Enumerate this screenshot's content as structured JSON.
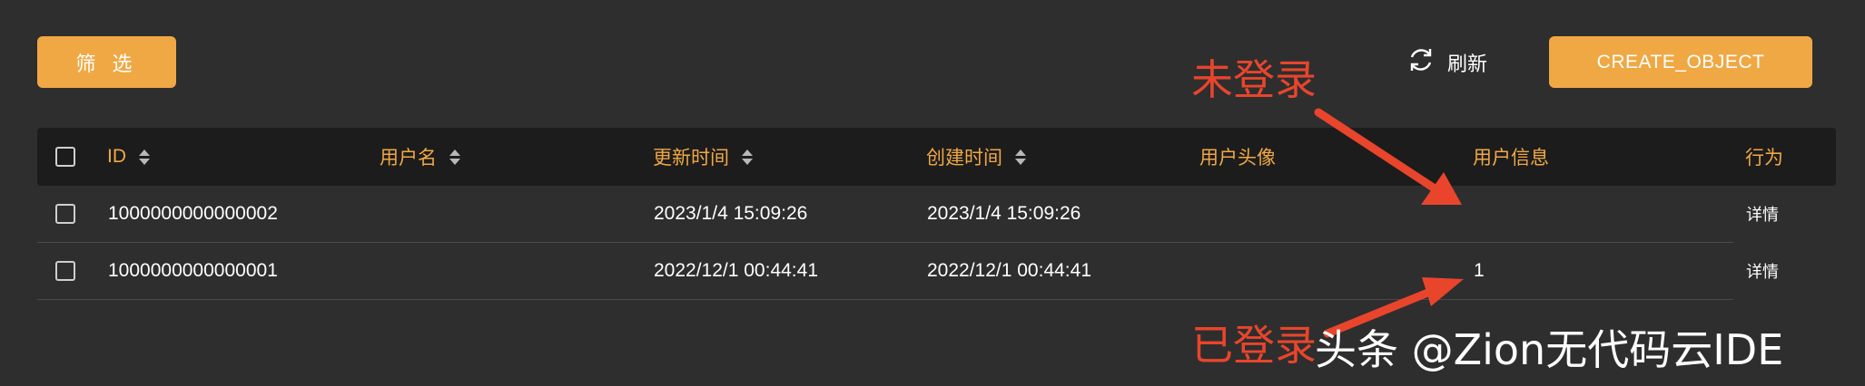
{
  "toolbar": {
    "filter_label": "筛 选",
    "refresh_label": "刷新",
    "create_label": "CREATE_OBJECT"
  },
  "table": {
    "columns": [
      {
        "label": "ID",
        "sortable": true
      },
      {
        "label": "用户名",
        "sortable": true
      },
      {
        "label": "更新时间",
        "sortable": true
      },
      {
        "label": "创建时间",
        "sortable": true
      },
      {
        "label": "用户头像",
        "sortable": false
      },
      {
        "label": "用户信息",
        "sortable": false
      },
      {
        "label": "行为",
        "sortable": false
      }
    ],
    "rows": [
      {
        "id": "1000000000000002",
        "username": "",
        "updated": "2023/1/4 15:09:26",
        "created": "2023/1/4 15:09:26",
        "avatar": "",
        "info": "",
        "action": "详情"
      },
      {
        "id": "1000000000000001",
        "username": "",
        "updated": "2022/12/1 00:44:41",
        "created": "2022/12/1 00:44:41",
        "avatar": "",
        "info": "1",
        "action": "详情"
      }
    ]
  },
  "annotations": {
    "not_logged_in": "未登录",
    "logged_in": "已登录"
  },
  "watermark": "头条 @Zion无代码云IDE",
  "colors": {
    "background": "#2e2e2e",
    "header_bg": "#1c1c1c",
    "accent": "#f0a844",
    "annotation": "#e8452c"
  },
  "icons": {
    "refresh": "refresh-icon",
    "sort": "sort-icon",
    "checkbox": "checkbox"
  }
}
